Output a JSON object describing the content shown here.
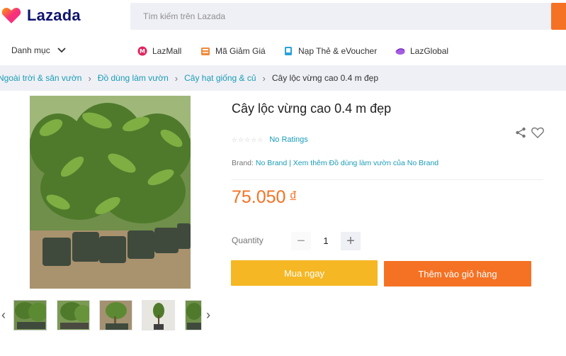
{
  "header": {
    "logo_text": "Lazada",
    "search_placeholder": "Tìm kiếm trên Lazada"
  },
  "nav": {
    "category_label": "Danh mục",
    "links": [
      {
        "label": "LazMall",
        "icon": "lazmall-icon"
      },
      {
        "label": "Mã Giảm Giá",
        "icon": "voucher-icon"
      },
      {
        "label": "Nạp Thẻ & eVoucher",
        "icon": "topup-card-icon"
      },
      {
        "label": "LazGlobal",
        "icon": "lazglobal-icon"
      }
    ]
  },
  "breadcrumb": {
    "items": [
      "Ngoài trời & sân vườn",
      "Đồ dùng làm vườn",
      "Cây hạt giống & củ"
    ],
    "current": "Cây lộc vừng cao 0.4 m đẹp"
  },
  "product": {
    "title": "Cây lộc vừng cao 0.4 m đẹp",
    "stars": "☆☆☆☆☆",
    "rating_text": "No Ratings",
    "brand_label": "Brand:",
    "brand_name": "No Brand",
    "brand_more": "| Xem thêm Đồ dùng làm vườn của No Brand",
    "price": "75.050",
    "currency": "đ",
    "quantity_label": "Quantity",
    "quantity_value": "1",
    "minus": "−",
    "plus": "+",
    "buy_now": "Mua ngay",
    "add_to_cart": "Thêm vào giỏ hàng"
  },
  "gallery": {
    "prev": "‹",
    "next": "›",
    "thumbnail_count": 5
  },
  "colors": {
    "accent_orange": "#f57224",
    "buy_yellow": "#f5b724",
    "link_blue": "#1a9cb7",
    "brand_navy": "#10156f"
  }
}
